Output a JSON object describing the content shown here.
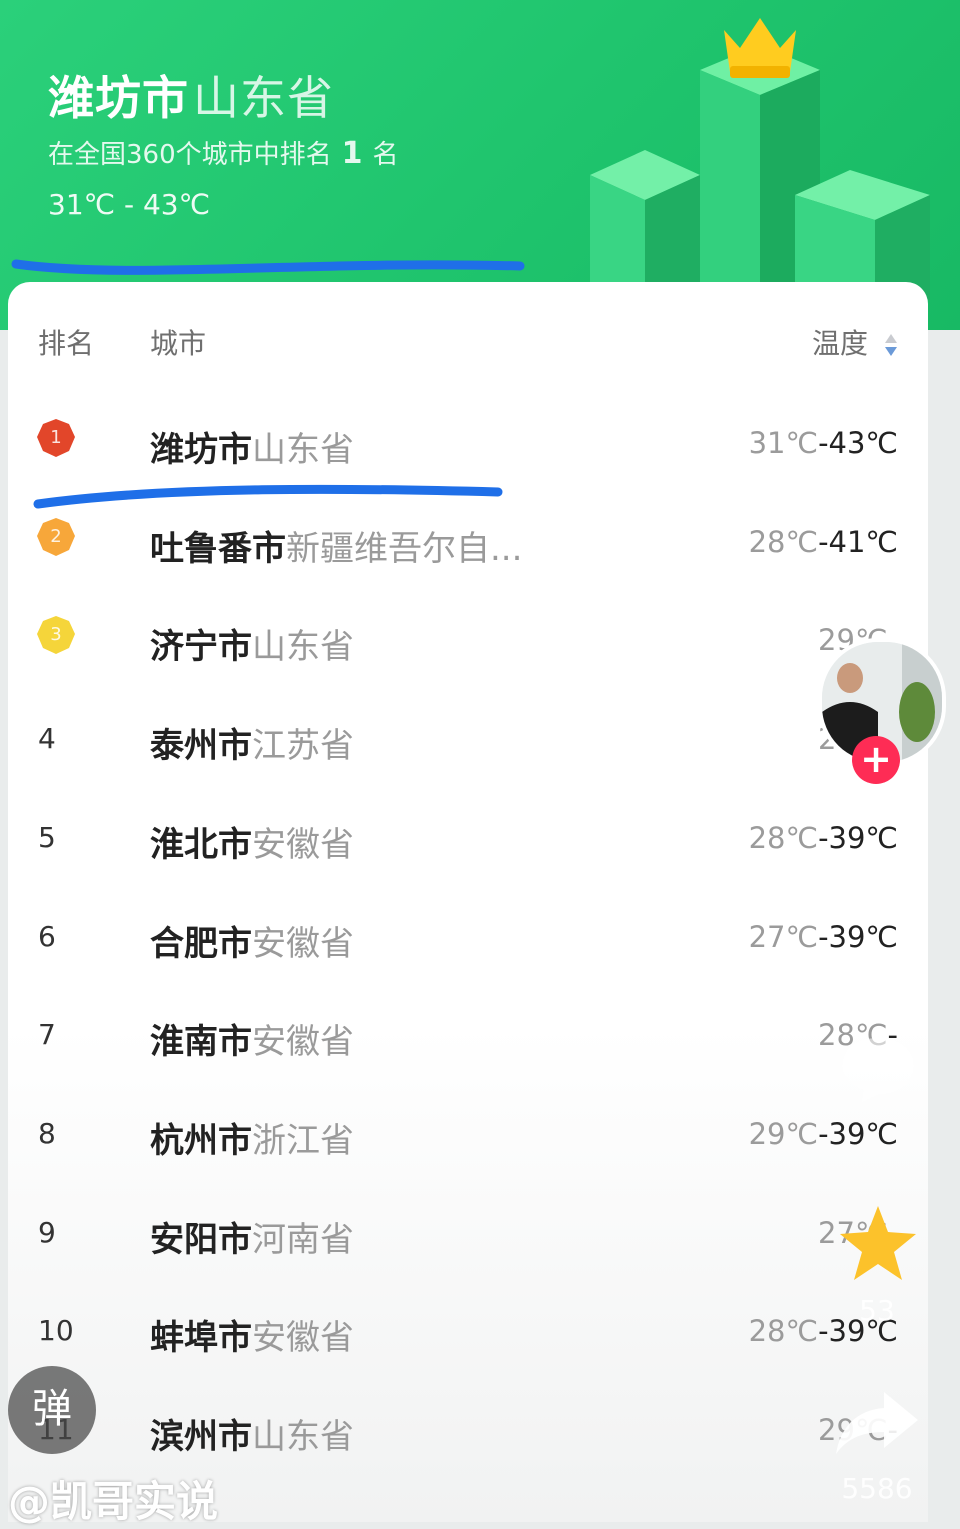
{
  "header": {
    "city": "潍坊市",
    "province": "山东省",
    "rank_prefix": "在全国360个城市中排名",
    "rank_value": "1",
    "rank_suffix": "名",
    "temp_range": "31℃ - 43℃"
  },
  "table": {
    "col_rank": "排名",
    "col_city": "城市",
    "col_temp": "温度",
    "rows": [
      {
        "rank": "1",
        "city": "潍坊市",
        "province": "山东省",
        "low": "31℃",
        "high": "-43℃",
        "medal_color": "#e2462a"
      },
      {
        "rank": "2",
        "city": "吐鲁番市",
        "province": "新疆维吾尔自...",
        "low": "28℃",
        "high": "-41℃",
        "medal_color": "#f7a73a"
      },
      {
        "rank": "3",
        "city": "济宁市",
        "province": "山东省",
        "low": "29℃",
        "high": "-",
        "medal_color": "#f5d53a"
      },
      {
        "rank": "4",
        "city": "泰州市",
        "province": "江苏省",
        "low": "28℃",
        "high": "-"
      },
      {
        "rank": "5",
        "city": "淮北市",
        "province": "安徽省",
        "low": "28℃",
        "high": "-39℃"
      },
      {
        "rank": "6",
        "city": "合肥市",
        "province": "安徽省",
        "low": "27℃",
        "high": "-39℃"
      },
      {
        "rank": "7",
        "city": "淮南市",
        "province": "安徽省",
        "low": "28℃",
        "high": "-"
      },
      {
        "rank": "8",
        "city": "杭州市",
        "province": "浙江省",
        "low": "29℃",
        "high": "-39℃"
      },
      {
        "rank": "9",
        "city": "安阳市",
        "province": "河南省",
        "low": "27℃",
        "high": "-"
      },
      {
        "rank": "10",
        "city": "蚌埠市",
        "province": "安徽省",
        "low": "28℃",
        "high": "-39℃"
      },
      {
        "rank": "11",
        "city": "滨州市",
        "province": "山东省",
        "low": "29℃",
        "high": "-"
      }
    ]
  },
  "overlay": {
    "favorite_count": "53",
    "share_count": "5586",
    "danmaku_label": "弹",
    "follow_label": "+",
    "author": "@凯哥实说"
  },
  "colors": {
    "hero_green": "#1fc46d",
    "annotation_blue": "#1f6fe8",
    "follow_red": "#fe2c55",
    "star_yellow": "#fcc22b"
  }
}
